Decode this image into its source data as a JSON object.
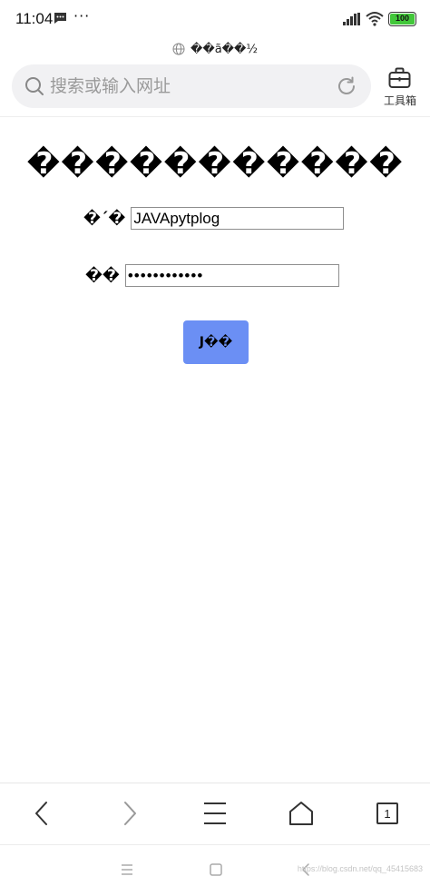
{
  "status_bar": {
    "time": "11:04",
    "more": "···",
    "battery": "100",
    "icons": [
      "message-icon",
      "signal-icon",
      "wifi-icon",
      "battery-icon"
    ]
  },
  "site": {
    "domain_text": "��ã��½"
  },
  "address_bar": {
    "placeholder": "搜索或输入网址",
    "toolbox_label": "工具箱",
    "icons": [
      "search-icon",
      "refresh-icon",
      "toolbox-icon"
    ]
  },
  "page": {
    "title": "�����������",
    "username_label": "�ˊ�",
    "username_value": "JAVApytplog",
    "password_label": "��",
    "password_value": "••••••••••••",
    "submit_label": "J��",
    "submit_color": "#6b8ff4"
  },
  "bottom_nav": {
    "tab_count": "1",
    "icons": [
      "back-icon",
      "forward-icon",
      "menu-icon",
      "home-icon",
      "tabs-icon"
    ]
  },
  "system_nav": {
    "icons": [
      "recents-icon",
      "home-square-icon",
      "system-back-icon"
    ]
  },
  "watermark": "https://blog.csdn.net/qq_45415683"
}
